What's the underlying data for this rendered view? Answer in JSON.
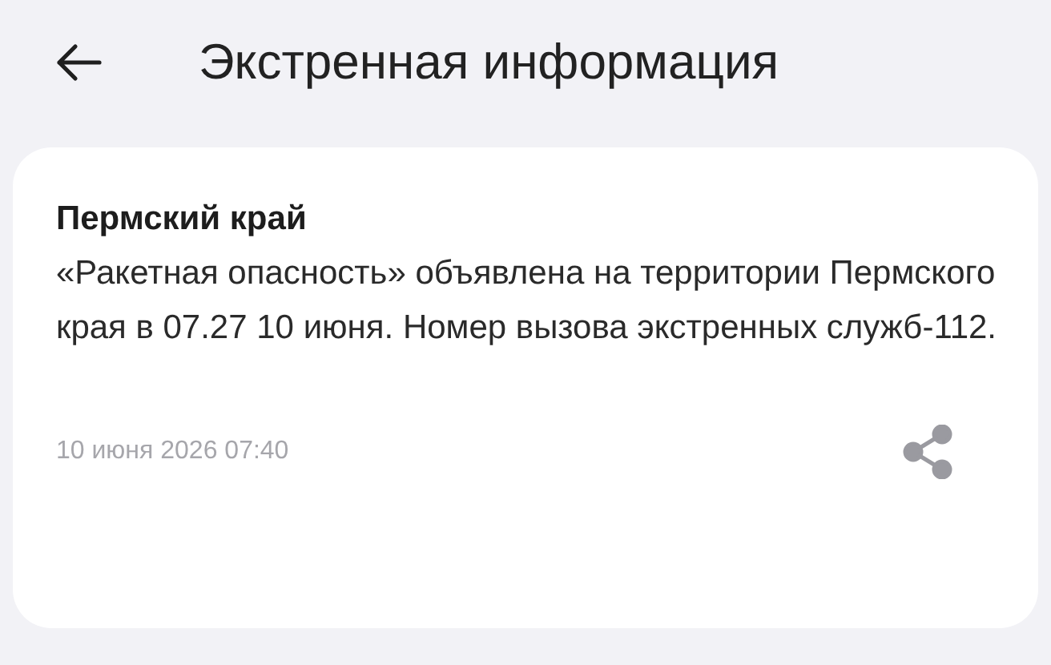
{
  "header": {
    "title": "Экстренная информация"
  },
  "alert": {
    "region": "Пермский край",
    "message": "«Ракетная опасность» объявлена на территории Пермского края в 07.27 10 июня. Номер вызова экстренных служб-112.",
    "timestamp": "10 июня 2026 07:40"
  }
}
